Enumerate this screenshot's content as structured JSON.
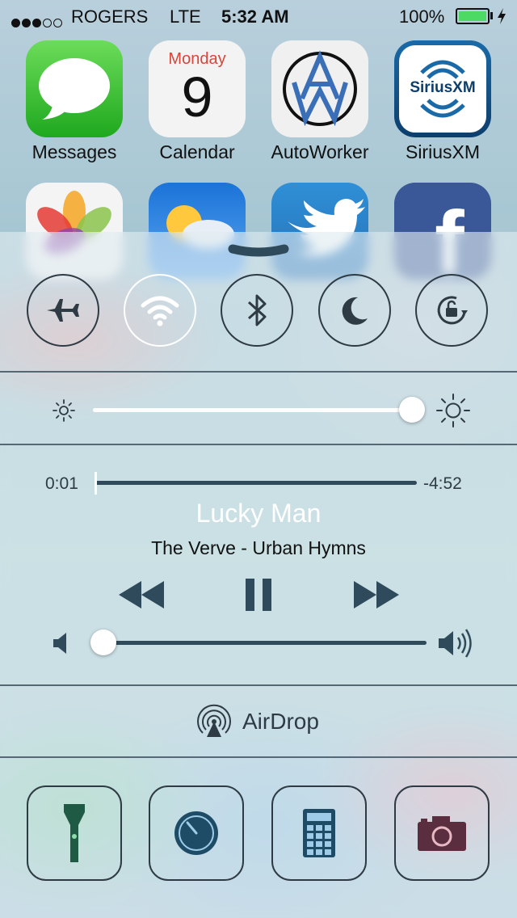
{
  "status_bar": {
    "signal_dots_filled": 3,
    "signal_dots_total": 5,
    "carrier": "ROGERS",
    "network": "LTE",
    "time": "5:32 AM",
    "battery_percent": "100%",
    "charging_icon": "bolt-icon"
  },
  "home_apps": [
    {
      "label": "Messages",
      "icon": "speech-bubble-icon"
    },
    {
      "label": "Calendar",
      "day_name": "Monday",
      "day_number": "9"
    },
    {
      "label": "AutoWorker",
      "icon_text": "AW"
    },
    {
      "label": "SiriusXM",
      "icon_text": "SiriusXM"
    },
    {
      "icon": "photos-icon"
    },
    {
      "icon": "weather-icon"
    },
    {
      "icon": "twitter-bird-icon"
    },
    {
      "icon": "facebook-icon",
      "icon_text": "f"
    }
  ],
  "control_center": {
    "grabber_icon": "chevron-down-icon",
    "toggles": [
      {
        "name": "airplane-mode",
        "icon": "airplane-icon",
        "on": false
      },
      {
        "name": "wifi",
        "icon": "wifi-icon",
        "on": true
      },
      {
        "name": "bluetooth",
        "icon": "bluetooth-icon",
        "on": false
      },
      {
        "name": "do-not-disturb",
        "icon": "moon-icon",
        "on": false
      },
      {
        "name": "rotation-lock",
        "icon": "rotation-lock-icon",
        "on": false
      }
    ],
    "brightness": {
      "level": 1.0,
      "low_icon": "sun-small-icon",
      "high_icon": "sun-large-icon"
    },
    "now_playing": {
      "elapsed": "0:01",
      "remaining": "-4:52",
      "progress": 0.003,
      "title": "Lucky Man",
      "subtitle": "The Verve - Urban Hymns",
      "controls": [
        "rewind-icon",
        "pause-icon",
        "fast-forward-icon"
      ],
      "volume": 0.0
    },
    "airdrop": {
      "label": "AirDrop",
      "icon": "airdrop-icon"
    },
    "shortcuts": [
      "flashlight-icon",
      "timer-icon",
      "calculator-icon",
      "camera-icon"
    ]
  },
  "colors": {
    "accent_dark": "#2f3b44",
    "battery_green": "#4cd964",
    "calendar_red": "#d6463a"
  }
}
